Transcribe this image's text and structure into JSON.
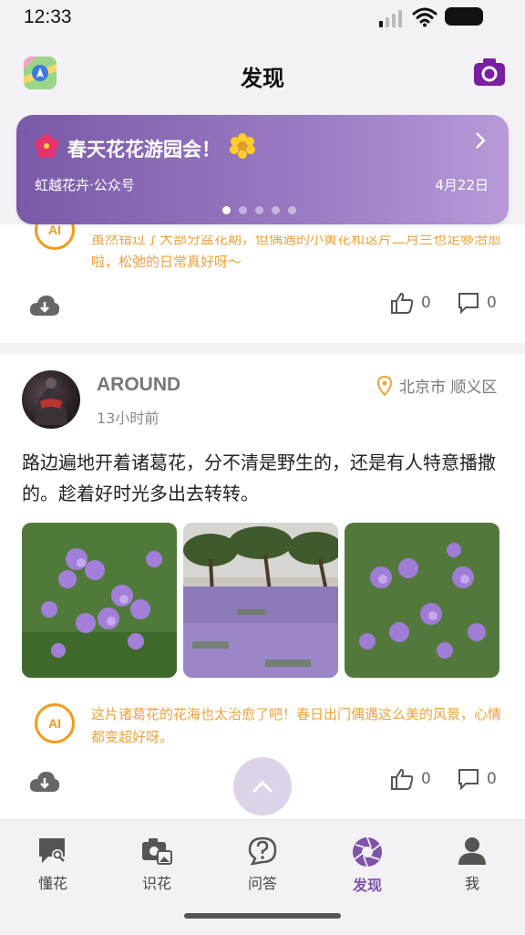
{
  "status": {
    "time": "12:33"
  },
  "header": {
    "title": "发现"
  },
  "banner": {
    "title": "春天花花游园会！",
    "source": "虹越花卉·公众号",
    "date": "4月22日",
    "slide_count": 5,
    "active_slide": 1
  },
  "card1": {
    "ai_text": "虽然错过了大部分盆花期，但偶遇的小黄花和这片二月兰也足够治愈啦，松弛的日常真好呀～",
    "likes": "0",
    "comments": "0"
  },
  "card2": {
    "username": "AROUND",
    "time": "13小时前",
    "location": "北京市 顺义区",
    "body": "路边遍地开着诸葛花，分不清是野生的，还是有人特意播撒的。趁着好时光多出去转转。",
    "ai_text": "这片诸葛花的花海也太治愈了吧！春日出门偶遇这么美的风景，心情都变超好呀。",
    "likes": "0",
    "comments": "0",
    "ai_badge": "AI"
  },
  "tabs": [
    {
      "label": "懂花",
      "icon": "chat-search-icon",
      "active": false
    },
    {
      "label": "识花",
      "icon": "camera-image-icon",
      "active": false
    },
    {
      "label": "问答",
      "icon": "question-icon",
      "active": false
    },
    {
      "label": "发现",
      "icon": "aperture-icon",
      "active": true
    },
    {
      "label": "我",
      "icon": "person-icon",
      "active": false
    }
  ],
  "colors": {
    "accent": "#7d54a8",
    "ai_orange": "#f29b1b",
    "banner_start": "#7a5aa8",
    "banner_end": "#b79ad7"
  }
}
